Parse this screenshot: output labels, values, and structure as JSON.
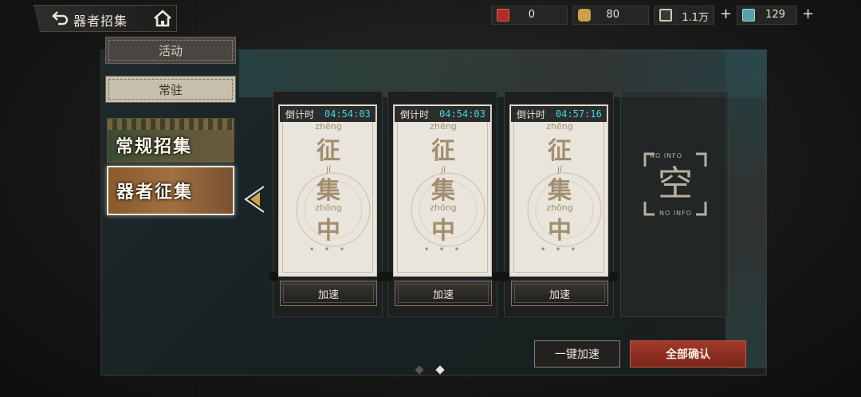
{
  "header": {
    "title": "器者招集",
    "back_icon": "back-arrow-icon",
    "home_icon": "home-icon"
  },
  "resources": [
    {
      "name": "red-card",
      "value": "0",
      "color": "#b02a2a"
    },
    {
      "name": "gold-bag",
      "value": "80",
      "color": "#c9a24a"
    },
    {
      "name": "coin",
      "value": "1.1万",
      "color": "#8e8a80"
    },
    {
      "name": "gem",
      "value": "129",
      "color": "#5aa0a8"
    }
  ],
  "tabs": {
    "activity": "活动",
    "standard": "常驻"
  },
  "categories": {
    "regular": "常规招集",
    "equip": "器者征集"
  },
  "tickets": [
    {
      "countdown_label": "倒计时",
      "time": "04:54:03",
      "char1": "征",
      "char2": "集",
      "char3": "中",
      "py1": "zhēng",
      "py2": "jí",
      "py3": "zhōng",
      "button": "加速"
    },
    {
      "countdown_label": "倒计时",
      "time": "04:54:03",
      "char1": "征",
      "char2": "集",
      "char3": "中",
      "py1": "zhēng",
      "py2": "jí",
      "py3": "zhōng",
      "button": "加速"
    },
    {
      "countdown_label": "倒计时",
      "time": "04:57:16",
      "char1": "征",
      "char2": "集",
      "char3": "中",
      "py1": "zhēng",
      "py2": "jí",
      "py3": "zhōng",
      "button": "加速"
    }
  ],
  "empty_slot": {
    "char": "空",
    "caption_top": "NO INFO",
    "caption_bottom": "NO INFO"
  },
  "buttons": {
    "all_speed": "一键加速",
    "confirm_all": "全部确认"
  },
  "colors": {
    "accent_cyan": "#3fd6e6",
    "confirm_red": "#a23a2a"
  }
}
